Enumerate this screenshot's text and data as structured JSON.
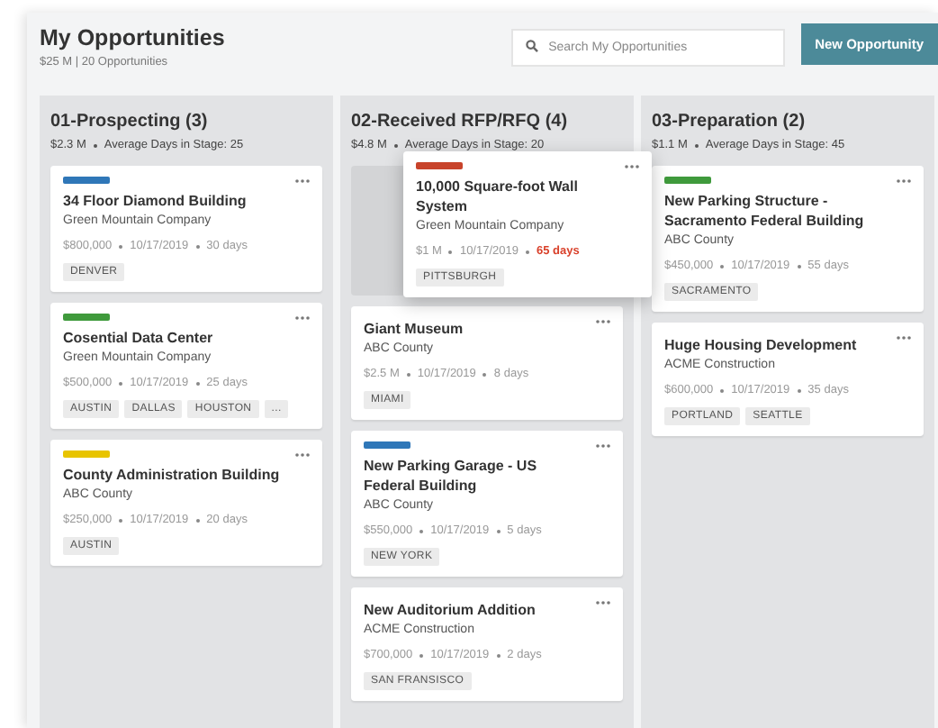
{
  "header": {
    "title": "My Opportunities",
    "summary": "$25 M | 20 Opportunities",
    "search": {
      "placeholder": "Search My Opportunities"
    },
    "new_button": "New Opportunity"
  },
  "columns": [
    {
      "title": "01-Prospecting (3)",
      "amount": "$2.3 M",
      "average": "Average Days in Stage: 25",
      "cards": [
        {
          "dragging": false,
          "color": "#2f77b8",
          "title": "34 Floor Diamond Building",
          "company": "Green Mountain Company",
          "amount": "$800,000",
          "date": "10/17/2019",
          "days": "30 days",
          "overdue": false,
          "tags": [
            "DENVER"
          ]
        },
        {
          "dragging": false,
          "color": "#3f9a3c",
          "title": "Cosential Data Center",
          "company": "Green Mountain Company",
          "amount": "$500,000",
          "date": "10/17/2019",
          "days": "25 days",
          "overdue": false,
          "tags": [
            "AUSTIN",
            "DALLAS",
            "HOUSTON",
            "..."
          ]
        },
        {
          "dragging": false,
          "color": "#e8c400",
          "title": "County Administration Building",
          "company": "ABC County",
          "amount": "$250,000",
          "date": "10/17/2019",
          "days": "20 days",
          "overdue": false,
          "tags": [
            "AUSTIN"
          ]
        }
      ]
    },
    {
      "title": "02-Received RFP/RFQ (4)",
      "amount": "$4.8 M",
      "average": "Average Days in Stage: 20",
      "cards": [
        {
          "dragging": true,
          "color": "#c8432b",
          "title": "10,000 Square-foot Wall System",
          "company": "Green Mountain Company",
          "amount": "$1 M",
          "date": "10/17/2019",
          "days": "65 days",
          "overdue": true,
          "tags": [
            "PITTSBURGH"
          ]
        },
        {
          "dragging": false,
          "title": "Giant Museum",
          "company": "ABC County",
          "amount": "$2.5 M",
          "date": "10/17/2019",
          "days": "8 days",
          "overdue": false,
          "tags": [
            "MIAMI"
          ]
        },
        {
          "dragging": false,
          "color": "#2f77b8",
          "title": "New Parking Garage - US Federal Building",
          "company": "ABC County",
          "amount": "$550,000",
          "date": "10/17/2019",
          "days": "5 days",
          "overdue": false,
          "tags": [
            "NEW YORK"
          ]
        },
        {
          "dragging": false,
          "title": "New Auditorium Addition",
          "company": "ACME Construction",
          "amount": "$700,000",
          "date": "10/17/2019",
          "days": "2 days",
          "overdue": false,
          "tags": [
            "SAN FRANSISCO"
          ]
        }
      ]
    },
    {
      "title": "03-Preparation (2)",
      "amount": "$1.1 M",
      "average": "Average Days in Stage: 45",
      "cards": [
        {
          "dragging": false,
          "color": "#3f9a3c",
          "title": "New Parking Structure - Sacramento Federal Building",
          "company": "ABC County",
          "amount": "$450,000",
          "date": "10/17/2019",
          "days": "55 days",
          "overdue": false,
          "tags": [
            "SACRAMENTO"
          ]
        },
        {
          "dragging": false,
          "title": "Huge Housing Development",
          "company": "ACME Construction",
          "amount": "$600,000",
          "date": "10/17/2019",
          "days": "35 days",
          "overdue": false,
          "tags": [
            "PORTLAND",
            "SEATTLE"
          ]
        }
      ]
    }
  ]
}
